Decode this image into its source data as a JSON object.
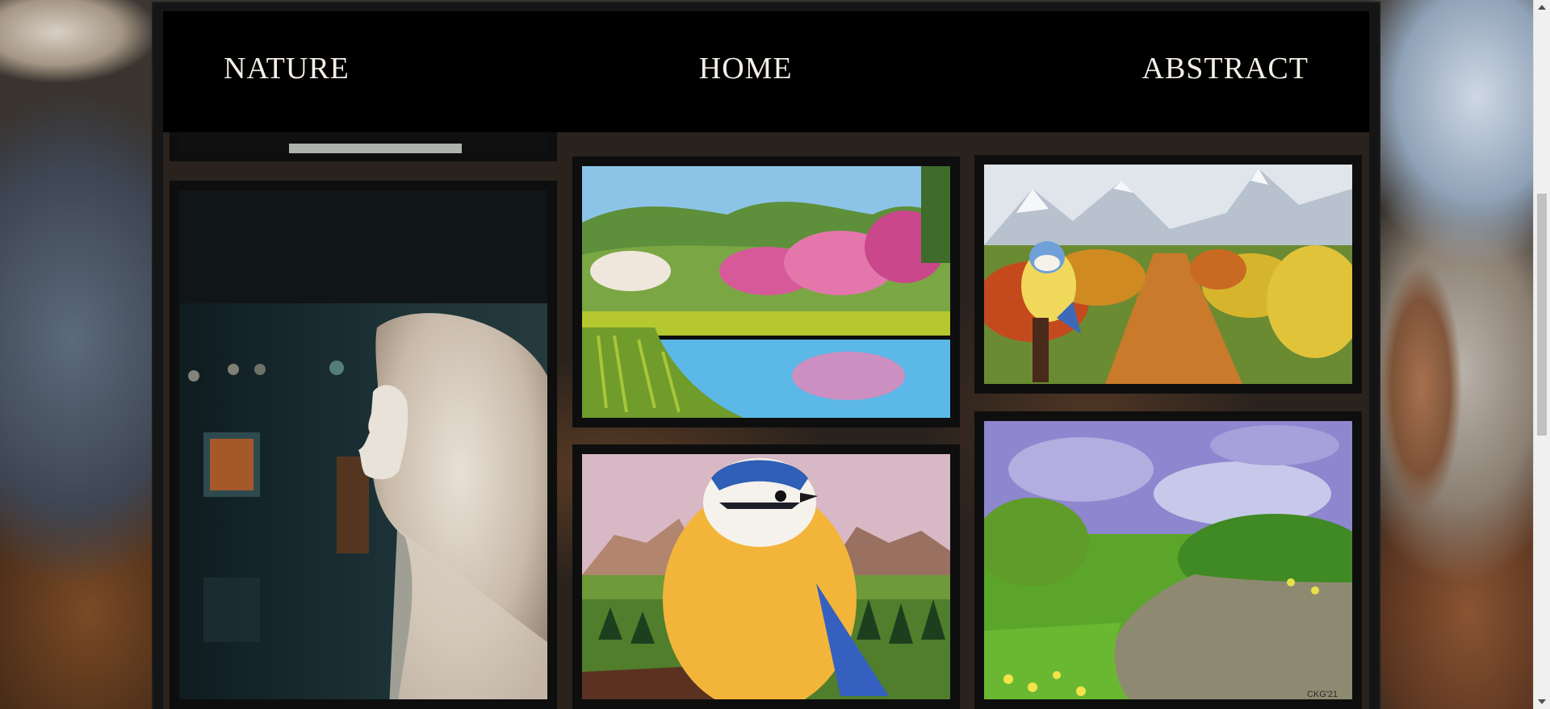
{
  "nav": {
    "left_label": "NATURE",
    "center_label": "HOME",
    "right_label": "ABSTRACT"
  },
  "gallery": {
    "items": [
      {
        "subject": "marble statue of veiled woman in museum"
      },
      {
        "subject": "painting of pond with blossoming trees"
      },
      {
        "subject": "painting of blue tit with mountain orchard path"
      },
      {
        "subject": "painting of blue tit perched before mountains"
      },
      {
        "subject": "painting of river meadow under cloudy sky",
        "signature": "CKG'21"
      }
    ]
  },
  "colors": {
    "frame": "#151515",
    "topbar": "#000000",
    "nav_text": "#f4efe8"
  }
}
